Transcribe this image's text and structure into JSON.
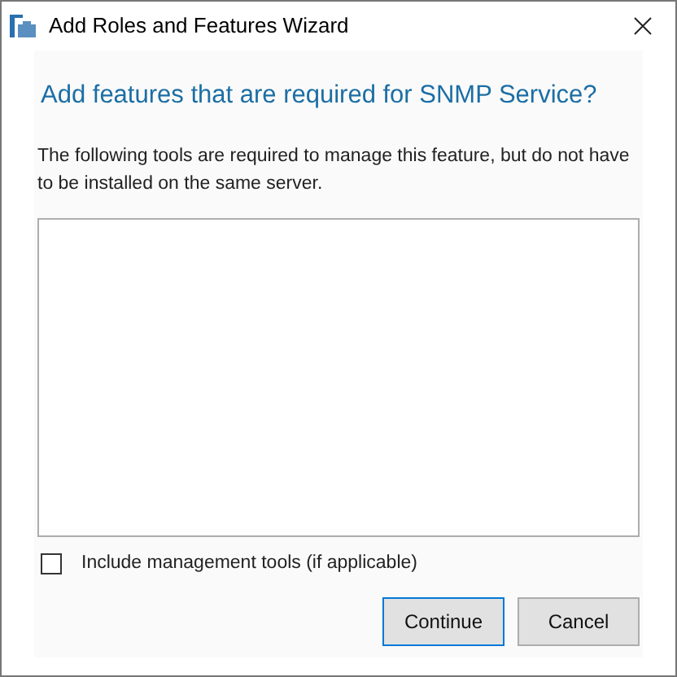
{
  "window": {
    "title": "Add Roles and Features Wizard"
  },
  "heading": "Add features that are required for SNMP Service?",
  "description": "The following tools are required to manage this feature, but do not have to be installed on the same server.",
  "include_tools": {
    "label": "Include management tools (if applicable)",
    "checked": false
  },
  "buttons": [
    {
      "label": "Continue",
      "default": true
    },
    {
      "label": "Cancel",
      "default": false
    }
  ]
}
